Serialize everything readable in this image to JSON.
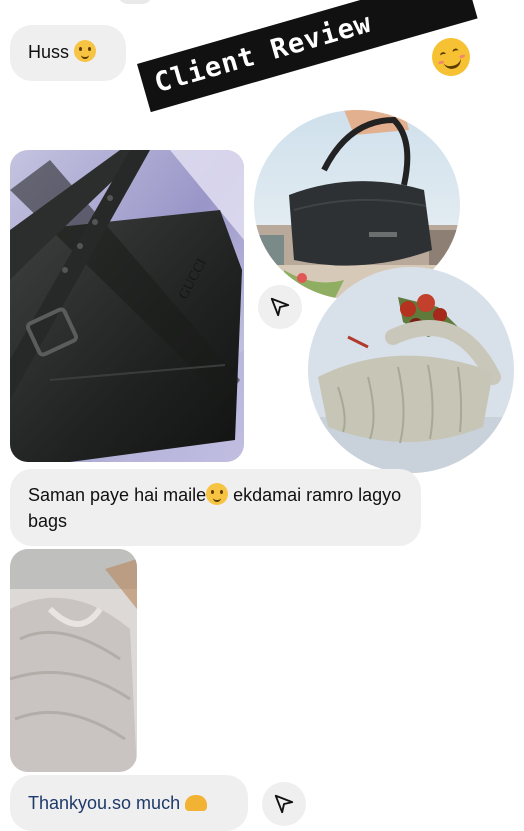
{
  "messages": {
    "first": "Huss",
    "second_part1": "Saman paye hai maile",
    "second_part2": " ekdamai ramro lagyo bags",
    "third": "Thankyou.so much"
  },
  "sticker": {
    "text": "Client Review"
  },
  "photo_brand": "GUCCI",
  "colors": {
    "bubble": "#efefef",
    "sticker_bg": "#111111",
    "emoji": "#f6c343"
  }
}
